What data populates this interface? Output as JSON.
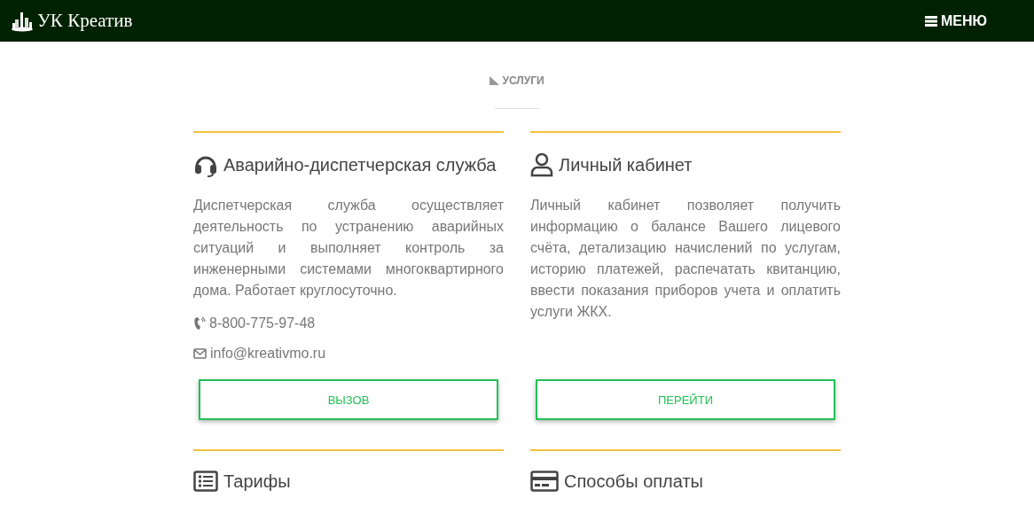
{
  "header": {
    "logo": "УК Креатив",
    "menu": "МЕНЮ"
  },
  "section_label": "УСЛУГИ",
  "cards": [
    {
      "kind": "headset",
      "title": "Аварийно-диспетчерская служба",
      "text": "Диспетчерская служба осуществляет деятельность по устранению аварийных ситуаций и выполняет контроль за инженерными системами многоквартирного дома. Работает круглосуточно.",
      "contacts": [
        {
          "kind": "phone",
          "text": "8-800-775-97-48"
        },
        {
          "kind": "email",
          "text": "info@kreativmo.ru"
        }
      ],
      "button": "ВЫЗОВ"
    },
    {
      "kind": "user",
      "title": "Личный кабинет",
      "text": "Личный кабинет позволяет получить информацию о балансе Вашего лицевого счёта, детализацию начислений по услугам, историю платежей, распечатать квитанцию, ввести показания приборов учета и оплатить услуги ЖКХ.",
      "button": "ПЕРЕЙТИ"
    },
    {
      "kind": "list",
      "title": "Тарифы"
    },
    {
      "kind": "card",
      "title": "Способы оплаты"
    }
  ]
}
